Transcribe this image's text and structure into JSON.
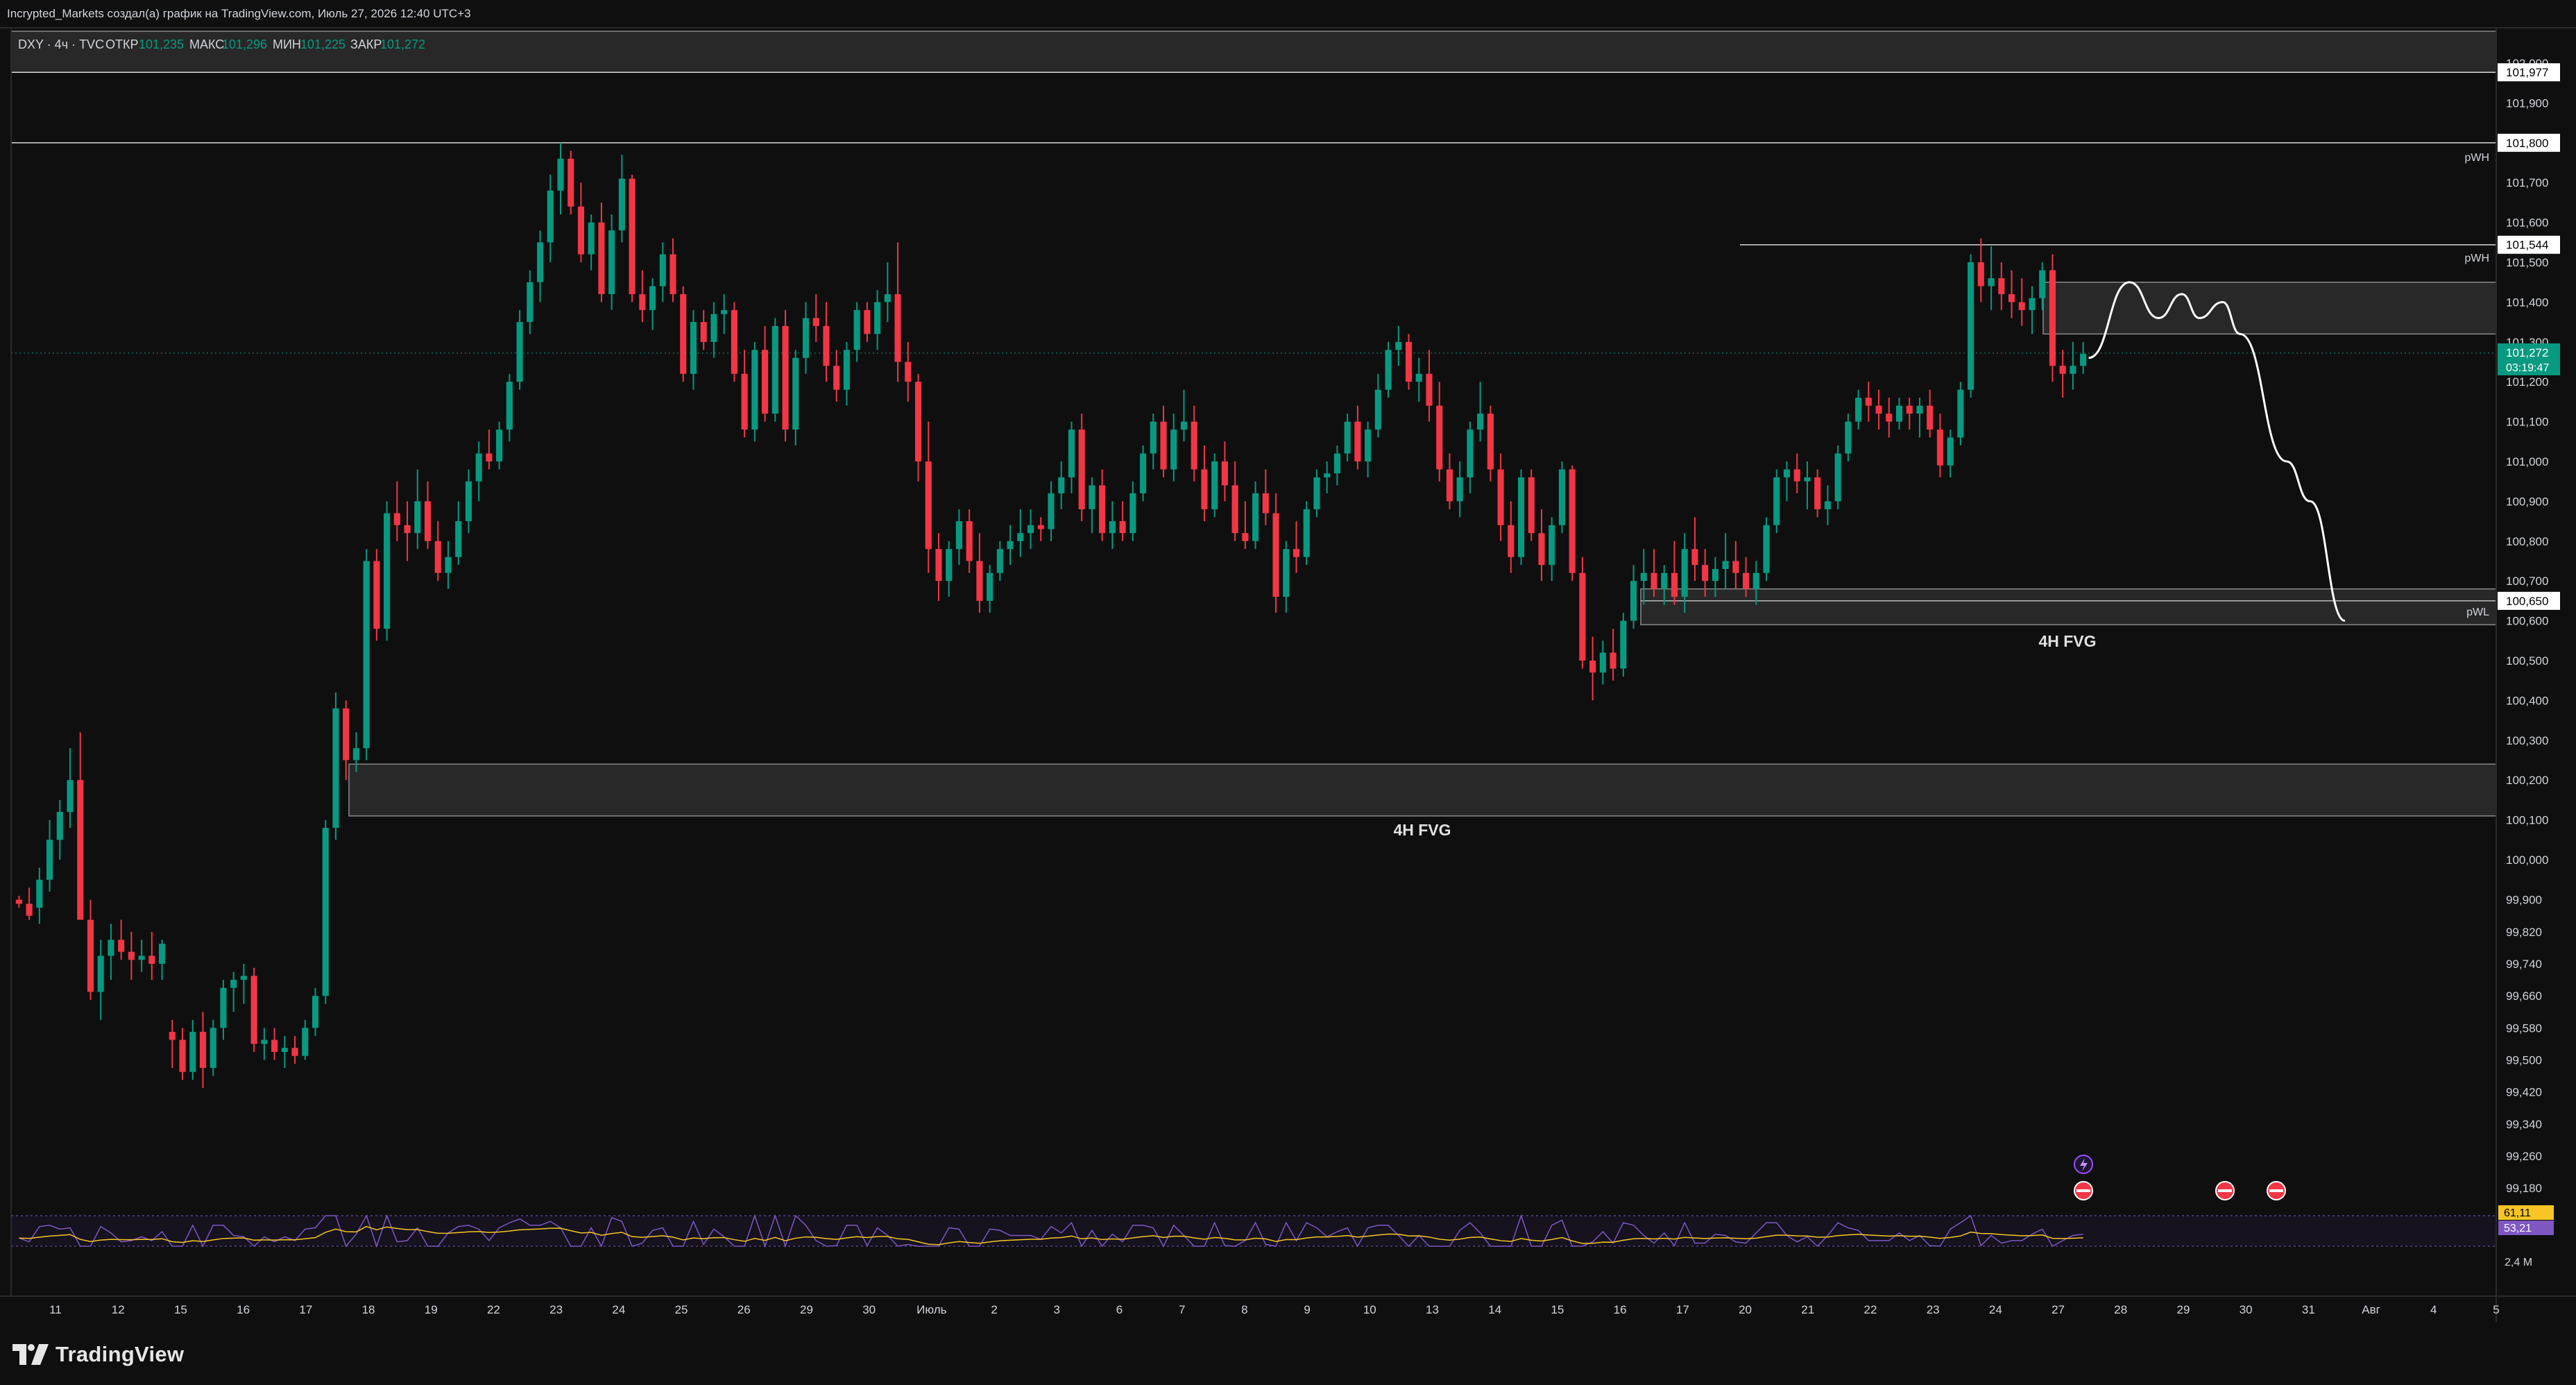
{
  "attribution": "Incrypted_Markets создал(а) график на TradingView.com, Июль 27, 2026 12:40 UTC+3",
  "logo_text": "TradingView",
  "colors": {
    "background": "#0f0f0f",
    "up": "#089981",
    "down": "#f23645",
    "grid": "#1c1c1c",
    "text": "#d1d4dc",
    "fvg_fill": "#2b2b2b",
    "fvg_border": "#8a8a8a",
    "rsi": "#7e57c2",
    "rsi_ma": "#f7c525"
  },
  "legend": {
    "symbol": "DXY · 4ч · TVC",
    "open_label": "ОТКР",
    "open": "101,235",
    "high_label": "МАКС",
    "high": "101,296",
    "low_label": "МИН",
    "low": "101,225",
    "close_label": "ЗАКР",
    "close": "101,272"
  },
  "annotations": {
    "fvg_label": "4H FVG",
    "pwh": "pWH",
    "pwl": "pWL"
  },
  "chart_data": {
    "type": "candlestick",
    "symbol": "DXY",
    "timeframe": "4H",
    "ylim": [
      99.12,
      102.08
    ],
    "price_ticks": [
      "102,000",
      "101,900",
      "101,800",
      "101,700",
      "101,600",
      "101,500",
      "101,400",
      "101,300",
      "101,200",
      "101,100",
      "101,000",
      "100,900",
      "100,800",
      "100,700",
      "100,600",
      "100,500",
      "100,400",
      "100,300",
      "100,200",
      "100,100",
      "100,000",
      "99,900",
      "99,820",
      "99,740",
      "99,660",
      "99,580",
      "99,500",
      "99,420",
      "99,340",
      "99,260",
      "99,180"
    ],
    "price_tags": [
      {
        "value": 101.977,
        "label": "101,977",
        "style": "dark"
      },
      {
        "value": 101.8,
        "label": "101,800",
        "style": "dark"
      },
      {
        "value": 101.544,
        "label": "101,544",
        "style": "dark"
      },
      {
        "value": 101.272,
        "label": "101,272",
        "style": "current",
        "sub": "03:19:47"
      },
      {
        "value": 100.65,
        "label": "100,650",
        "style": "dark"
      }
    ],
    "x_labels": [
      "11",
      "12",
      "15",
      "16",
      "17",
      "18",
      "19",
      "22",
      "23",
      "24",
      "25",
      "26",
      "29",
      "30",
      "Июль",
      "2",
      "3",
      "6",
      "7",
      "8",
      "9",
      "10",
      "13",
      "14",
      "15",
      "16",
      "17",
      "20",
      "21",
      "22",
      "23",
      "24",
      "27",
      "28",
      "29",
      "30",
      "31",
      "Авг",
      "4",
      "5"
    ],
    "levels": [
      {
        "name": "top-line",
        "value": 101.977
      },
      {
        "name": "pwh-old",
        "value": 101.8
      },
      {
        "name": "pwh-recent",
        "value": 101.544
      }
    ],
    "zones": [
      {
        "name": "supply-box",
        "top": 101.45,
        "bottom": 101.32
      },
      {
        "name": "fvg-upper",
        "top": 100.68,
        "bottom": 100.59
      },
      {
        "name": "fvg-lower",
        "top": 100.24,
        "bottom": 100.11
      },
      {
        "name": "top-band",
        "top": 102.08,
        "bottom": 101.977
      }
    ],
    "projection": [
      [
        101.26,
        0
      ],
      [
        101.45,
        7
      ],
      [
        101.36,
        12
      ],
      [
        101.42,
        16
      ],
      [
        101.36,
        19
      ],
      [
        101.4,
        23
      ],
      [
        101.32,
        26
      ],
      [
        101.0,
        34
      ],
      [
        100.9,
        38
      ],
      [
        100.6,
        44
      ]
    ],
    "candles": [
      [
        99.9,
        99.91,
        99.88,
        99.89
      ],
      [
        99.89,
        99.93,
        99.85,
        99.86
      ],
      [
        99.88,
        99.98,
        99.84,
        99.95
      ],
      [
        99.95,
        100.1,
        99.92,
        100.05
      ],
      [
        100.05,
        100.15,
        100.0,
        100.12
      ],
      [
        100.12,
        100.28,
        100.08,
        100.2
      ],
      [
        100.2,
        100.32,
        99.85,
        99.85
      ],
      [
        99.85,
        99.9,
        99.65,
        99.67
      ],
      [
        99.67,
        99.8,
        99.6,
        99.76
      ],
      [
        99.76,
        99.84,
        99.7,
        99.8
      ],
      [
        99.8,
        99.85,
        99.75,
        99.77
      ],
      [
        99.77,
        99.82,
        99.7,
        99.75
      ],
      [
        99.75,
        99.8,
        99.72,
        99.76
      ],
      [
        99.76,
        99.82,
        99.7,
        99.74
      ],
      [
        99.74,
        99.8,
        99.7,
        99.79
      ],
      [
        99.57,
        99.6,
        99.48,
        99.55
      ],
      [
        99.55,
        99.58,
        99.45,
        99.47
      ],
      [
        99.47,
        99.6,
        99.45,
        99.57
      ],
      [
        99.57,
        99.62,
        99.43,
        99.48
      ],
      [
        99.48,
        99.6,
        99.46,
        99.58
      ],
      [
        99.58,
        99.7,
        99.55,
        99.68
      ],
      [
        99.68,
        99.72,
        99.62,
        99.7
      ],
      [
        99.7,
        99.74,
        99.64,
        99.71
      ],
      [
        99.71,
        99.73,
        99.52,
        99.54
      ],
      [
        99.54,
        99.58,
        99.5,
        99.55
      ],
      [
        99.55,
        99.58,
        99.5,
        99.52
      ],
      [
        99.52,
        99.56,
        99.48,
        99.53
      ],
      [
        99.53,
        99.56,
        99.49,
        99.51
      ],
      [
        99.51,
        99.6,
        99.5,
        99.58
      ],
      [
        99.58,
        99.68,
        99.56,
        99.66
      ],
      [
        99.66,
        100.1,
        99.64,
        100.08
      ],
      [
        100.08,
        100.42,
        100.05,
        100.38
      ],
      [
        100.38,
        100.4,
        100.2,
        100.25
      ],
      [
        100.25,
        100.32,
        100.22,
        100.28
      ],
      [
        100.28,
        100.78,
        100.25,
        100.75
      ],
      [
        100.75,
        100.78,
        100.55,
        100.58
      ],
      [
        100.58,
        100.9,
        100.55,
        100.87
      ],
      [
        100.87,
        100.95,
        100.8,
        100.84
      ],
      [
        100.84,
        100.9,
        100.75,
        100.82
      ],
      [
        100.82,
        100.98,
        100.78,
        100.9
      ],
      [
        100.9,
        100.95,
        100.78,
        100.8
      ],
      [
        100.8,
        100.85,
        100.7,
        100.72
      ],
      [
        100.72,
        100.8,
        100.68,
        100.76
      ],
      [
        100.76,
        100.9,
        100.74,
        100.85
      ],
      [
        100.85,
        100.98,
        100.82,
        100.95
      ],
      [
        100.95,
        101.05,
        100.9,
        101.02
      ],
      [
        101.02,
        101.08,
        100.98,
        101.0
      ],
      [
        101.0,
        101.1,
        100.98,
        101.08
      ],
      [
        101.08,
        101.22,
        101.05,
        101.2
      ],
      [
        101.2,
        101.38,
        101.18,
        101.35
      ],
      [
        101.35,
        101.48,
        101.32,
        101.45
      ],
      [
        101.45,
        101.58,
        101.4,
        101.55
      ],
      [
        101.55,
        101.72,
        101.5,
        101.68
      ],
      [
        101.68,
        101.8,
        101.62,
        101.76
      ],
      [
        101.76,
        101.78,
        101.62,
        101.64
      ],
      [
        101.64,
        101.7,
        101.5,
        101.52
      ],
      [
        101.52,
        101.62,
        101.48,
        101.6
      ],
      [
        101.6,
        101.65,
        101.4,
        101.42
      ],
      [
        101.42,
        101.62,
        101.38,
        101.58
      ],
      [
        101.58,
        101.77,
        101.55,
        101.71
      ],
      [
        101.71,
        101.72,
        101.4,
        101.42
      ],
      [
        101.42,
        101.48,
        101.35,
        101.38
      ],
      [
        101.38,
        101.46,
        101.33,
        101.44
      ],
      [
        101.44,
        101.55,
        101.4,
        101.52
      ],
      [
        101.52,
        101.56,
        101.4,
        101.42
      ],
      [
        101.42,
        101.44,
        101.2,
        101.22
      ],
      [
        101.22,
        101.38,
        101.18,
        101.35
      ],
      [
        101.35,
        101.38,
        101.28,
        101.3
      ],
      [
        101.3,
        101.4,
        101.26,
        101.37
      ],
      [
        101.37,
        101.42,
        101.32,
        101.38
      ],
      [
        101.38,
        101.4,
        101.2,
        101.22
      ],
      [
        101.22,
        101.28,
        101.06,
        101.08
      ],
      [
        101.08,
        101.3,
        101.05,
        101.28
      ],
      [
        101.28,
        101.34,
        101.1,
        101.12
      ],
      [
        101.12,
        101.36,
        101.1,
        101.34
      ],
      [
        101.34,
        101.38,
        101.05,
        101.08
      ],
      [
        101.08,
        101.28,
        101.04,
        101.26
      ],
      [
        101.26,
        101.4,
        101.22,
        101.36
      ],
      [
        101.36,
        101.42,
        101.3,
        101.34
      ],
      [
        101.34,
        101.4,
        101.2,
        101.24
      ],
      [
        101.24,
        101.28,
        101.15,
        101.18
      ],
      [
        101.18,
        101.3,
        101.14,
        101.28
      ],
      [
        101.28,
        101.4,
        101.25,
        101.38
      ],
      [
        101.38,
        101.4,
        101.3,
        101.32
      ],
      [
        101.32,
        101.43,
        101.28,
        101.4
      ],
      [
        101.4,
        101.5,
        101.35,
        101.42
      ],
      [
        101.42,
        101.55,
        101.2,
        101.25
      ],
      [
        101.25,
        101.3,
        101.15,
        101.2
      ],
      [
        101.2,
        101.22,
        100.95,
        101.0
      ],
      [
        101.0,
        101.1,
        100.72,
        100.78
      ],
      [
        100.78,
        100.82,
        100.65,
        100.7
      ],
      [
        100.7,
        100.8,
        100.66,
        100.78
      ],
      [
        100.78,
        100.88,
        100.74,
        100.85
      ],
      [
        100.85,
        100.88,
        100.72,
        100.75
      ],
      [
        100.75,
        100.82,
        100.62,
        100.65
      ],
      [
        100.65,
        100.74,
        100.62,
        100.72
      ],
      [
        100.72,
        100.8,
        100.7,
        100.78
      ],
      [
        100.78,
        100.84,
        100.74,
        100.8
      ],
      [
        100.8,
        100.88,
        100.76,
        100.82
      ],
      [
        100.82,
        100.88,
        100.78,
        100.84
      ],
      [
        100.84,
        100.86,
        100.8,
        100.83
      ],
      [
        100.83,
        100.95,
        100.8,
        100.92
      ],
      [
        100.92,
        101.0,
        100.88,
        100.96
      ],
      [
        100.96,
        101.1,
        100.92,
        101.08
      ],
      [
        101.08,
        101.12,
        100.85,
        100.88
      ],
      [
        100.88,
        100.96,
        100.82,
        100.94
      ],
      [
        100.94,
        100.98,
        100.8,
        100.82
      ],
      [
        100.82,
        100.9,
        100.78,
        100.85
      ],
      [
        100.85,
        100.9,
        100.8,
        100.82
      ],
      [
        100.82,
        100.95,
        100.8,
        100.92
      ],
      [
        100.92,
        101.04,
        100.9,
        101.02
      ],
      [
        101.02,
        101.12,
        100.98,
        101.1
      ],
      [
        101.1,
        101.14,
        100.96,
        100.98
      ],
      [
        100.98,
        101.12,
        100.95,
        101.08
      ],
      [
        101.08,
        101.18,
        101.05,
        101.1
      ],
      [
        101.1,
        101.14,
        100.95,
        100.98
      ],
      [
        100.98,
        101.04,
        100.85,
        100.88
      ],
      [
        100.88,
        101.02,
        100.86,
        101.0
      ],
      [
        101.0,
        101.05,
        100.9,
        100.94
      ],
      [
        100.94,
        101.0,
        100.8,
        100.82
      ],
      [
        100.82,
        100.9,
        100.78,
        100.8
      ],
      [
        100.8,
        100.95,
        100.78,
        100.92
      ],
      [
        100.92,
        100.98,
        100.84,
        100.87
      ],
      [
        100.87,
        100.92,
        100.62,
        100.66
      ],
      [
        100.66,
        100.8,
        100.62,
        100.78
      ],
      [
        100.78,
        100.85,
        100.72,
        100.76
      ],
      [
        100.76,
        100.9,
        100.74,
        100.88
      ],
      [
        100.88,
        100.98,
        100.86,
        100.96
      ],
      [
        100.96,
        101.0,
        100.92,
        100.97
      ],
      [
        100.97,
        101.04,
        100.94,
        101.02
      ],
      [
        101.02,
        101.12,
        101.0,
        101.1
      ],
      [
        101.1,
        101.14,
        100.98,
        101.0
      ],
      [
        101.0,
        101.1,
        100.96,
        101.08
      ],
      [
        101.08,
        101.22,
        101.06,
        101.18
      ],
      [
        101.18,
        101.3,
        101.16,
        101.28
      ],
      [
        101.28,
        101.34,
        101.24,
        101.3
      ],
      [
        101.3,
        101.32,
        101.18,
        101.2
      ],
      [
        101.2,
        101.26,
        101.15,
        101.22
      ],
      [
        101.22,
        101.28,
        101.1,
        101.14
      ],
      [
        101.14,
        101.2,
        100.95,
        100.98
      ],
      [
        100.98,
        101.02,
        100.88,
        100.9
      ],
      [
        100.9,
        101.0,
        100.86,
        100.96
      ],
      [
        100.96,
        101.1,
        100.92,
        101.08
      ],
      [
        101.08,
        101.2,
        101.05,
        101.12
      ],
      [
        101.12,
        101.14,
        100.95,
        100.98
      ],
      [
        100.98,
        101.02,
        100.8,
        100.84
      ],
      [
        100.84,
        100.9,
        100.72,
        100.76
      ],
      [
        100.76,
        100.98,
        100.74,
        100.96
      ],
      [
        100.96,
        100.98,
        100.8,
        100.82
      ],
      [
        100.82,
        100.88,
        100.7,
        100.74
      ],
      [
        100.74,
        100.86,
        100.7,
        100.84
      ],
      [
        100.84,
        101.0,
        100.82,
        100.98
      ],
      [
        100.98,
        100.99,
        100.7,
        100.72
      ],
      [
        100.72,
        100.76,
        100.48,
        100.5
      ],
      [
        100.5,
        100.56,
        100.4,
        100.47
      ],
      [
        100.47,
        100.55,
        100.44,
        100.52
      ],
      [
        100.52,
        100.58,
        100.45,
        100.48
      ],
      [
        100.48,
        100.62,
        100.46,
        100.6
      ],
      [
        100.6,
        100.74,
        100.58,
        100.7
      ],
      [
        100.7,
        100.78,
        100.64,
        100.72
      ],
      [
        100.72,
        100.78,
        100.66,
        100.68
      ],
      [
        100.68,
        100.74,
        100.64,
        100.72
      ],
      [
        100.72,
        100.8,
        100.64,
        100.66
      ],
      [
        100.66,
        100.82,
        100.62,
        100.78
      ],
      [
        100.78,
        100.86,
        100.7,
        100.74
      ],
      [
        100.74,
        100.78,
        100.66,
        100.7
      ],
      [
        100.7,
        100.76,
        100.66,
        100.73
      ],
      [
        100.73,
        100.82,
        100.68,
        100.75
      ],
      [
        100.75,
        100.8,
        100.68,
        100.72
      ],
      [
        100.72,
        100.76,
        100.66,
        100.68
      ],
      [
        100.68,
        100.75,
        100.64,
        100.72
      ],
      [
        100.72,
        100.86,
        100.7,
        100.84
      ],
      [
        100.84,
        100.98,
        100.82,
        100.96
      ],
      [
        100.96,
        101.0,
        100.9,
        100.98
      ],
      [
        100.98,
        101.02,
        100.92,
        100.95
      ],
      [
        100.95,
        101.0,
        100.88,
        100.96
      ],
      [
        100.96,
        100.98,
        100.86,
        100.88
      ],
      [
        100.88,
        100.94,
        100.84,
        100.9
      ],
      [
        100.9,
        101.04,
        100.88,
        101.02
      ],
      [
        101.02,
        101.12,
        101.0,
        101.1
      ],
      [
        101.1,
        101.18,
        101.08,
        101.16
      ],
      [
        101.16,
        101.2,
        101.1,
        101.14
      ],
      [
        101.14,
        101.18,
        101.08,
        101.12
      ],
      [
        101.12,
        101.16,
        101.06,
        101.1
      ],
      [
        101.1,
        101.16,
        101.08,
        101.14
      ],
      [
        101.14,
        101.16,
        101.08,
        101.12
      ],
      [
        101.12,
        101.16,
        101.06,
        101.14
      ],
      [
        101.14,
        101.18,
        101.06,
        101.08
      ],
      [
        101.08,
        101.12,
        100.96,
        100.99
      ],
      [
        100.99,
        101.08,
        100.96,
        101.06
      ],
      [
        101.06,
        101.2,
        101.04,
        101.18
      ],
      [
        101.18,
        101.52,
        101.16,
        101.5
      ],
      [
        101.5,
        101.56,
        101.4,
        101.44
      ],
      [
        101.44,
        101.54,
        101.38,
        101.46
      ],
      [
        101.46,
        101.5,
        101.38,
        101.42
      ],
      [
        101.42,
        101.48,
        101.36,
        101.4
      ],
      [
        101.4,
        101.46,
        101.34,
        101.38
      ],
      [
        101.38,
        101.44,
        101.32,
        101.41
      ],
      [
        101.41,
        101.5,
        101.38,
        101.48
      ],
      [
        101.48,
        101.52,
        101.2,
        101.24
      ],
      [
        101.24,
        101.28,
        101.16,
        101.22
      ],
      [
        101.22,
        101.3,
        101.18,
        101.24
      ],
      [
        101.24,
        101.3,
        101.22,
        101.27
      ]
    ],
    "rsi": {
      "value": "53,21",
      "ma": "61,11",
      "label_volume_axis": "2,4 M"
    }
  }
}
